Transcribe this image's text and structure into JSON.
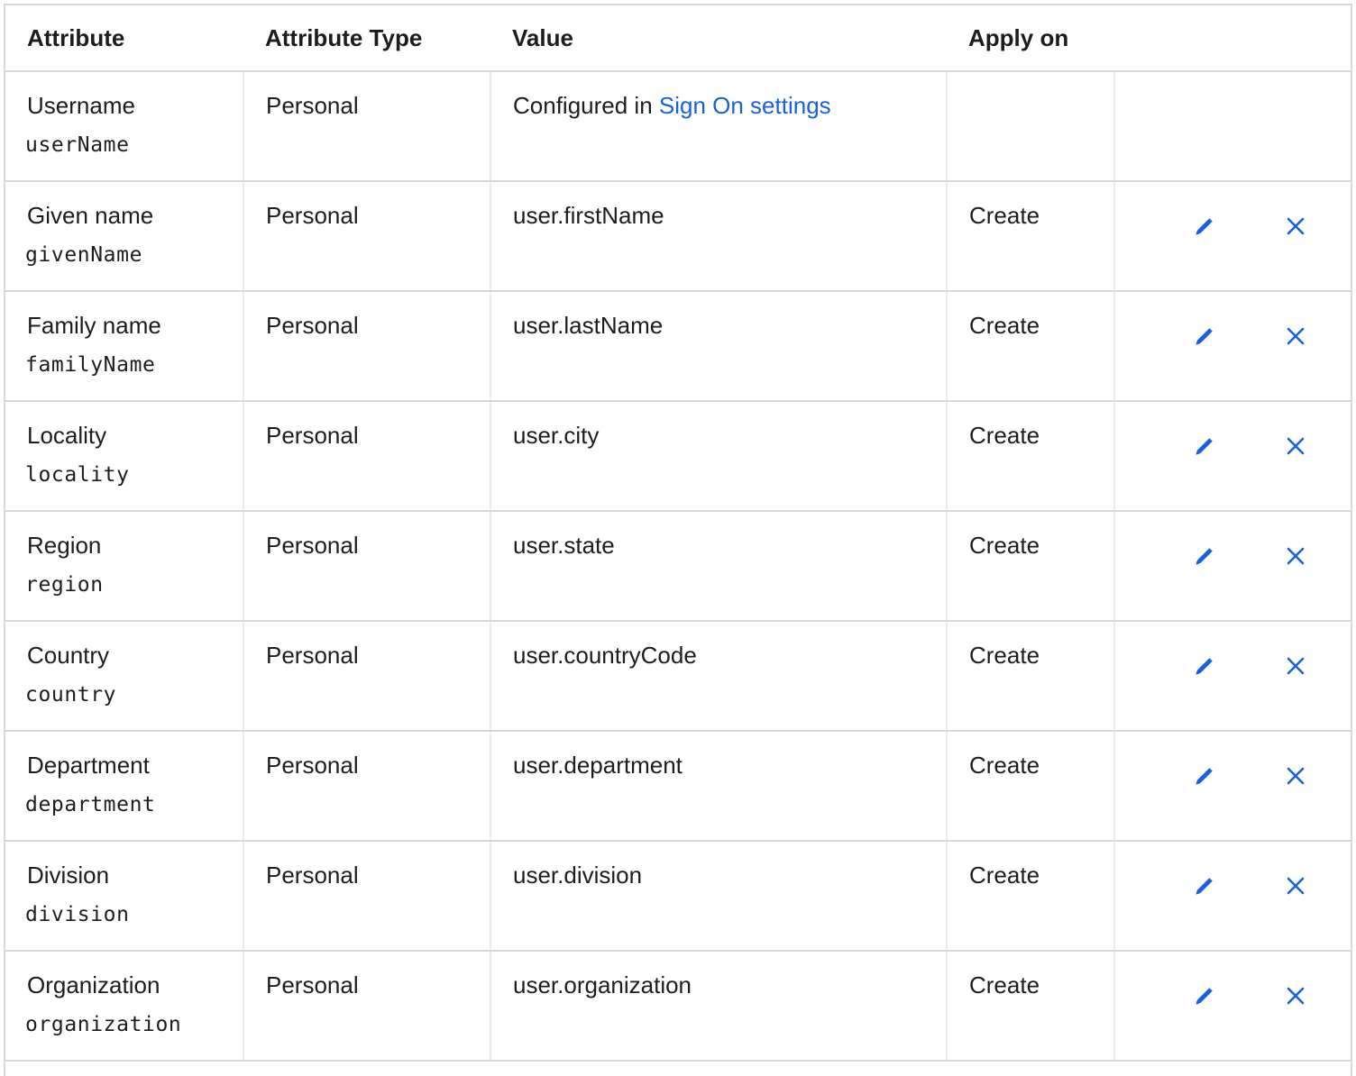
{
  "table": {
    "headers": {
      "attribute": "Attribute",
      "attribute_type": "Attribute Type",
      "value": "Value",
      "apply_on": "Apply on"
    },
    "rows": [
      {
        "label": "Username",
        "key": "userName",
        "type": "Personal",
        "value_prefix": "Configured in ",
        "value_link": "Sign On settings",
        "apply_on": "",
        "editable": false
      },
      {
        "label": "Given name",
        "key": "givenName",
        "type": "Personal",
        "value": "user.firstName",
        "apply_on": "Create",
        "editable": true
      },
      {
        "label": "Family name",
        "key": "familyName",
        "type": "Personal",
        "value": "user.lastName",
        "apply_on": "Create",
        "editable": true
      },
      {
        "label": "Locality",
        "key": "locality",
        "type": "Personal",
        "value": "user.city",
        "apply_on": "Create",
        "editable": true
      },
      {
        "label": "Region",
        "key": "region",
        "type": "Personal",
        "value": "user.state",
        "apply_on": "Create",
        "editable": true
      },
      {
        "label": "Country",
        "key": "country",
        "type": "Personal",
        "value": "user.countryCode",
        "apply_on": "Create",
        "editable": true
      },
      {
        "label": "Department",
        "key": "department",
        "type": "Personal",
        "value": "user.department",
        "apply_on": "Create",
        "editable": true
      },
      {
        "label": "Division",
        "key": "division",
        "type": "Personal",
        "value": "user.division",
        "apply_on": "Create",
        "editable": true
      },
      {
        "label": "Organization",
        "key": "organization",
        "type": "Personal",
        "value": "user.organization",
        "apply_on": "Create",
        "editable": true
      }
    ]
  },
  "icons": {
    "edit": "pencil-icon",
    "delete": "close-icon"
  },
  "colors": {
    "accent": "#1662dd",
    "border": "#d7d7dc",
    "text": "#1d1d21"
  }
}
